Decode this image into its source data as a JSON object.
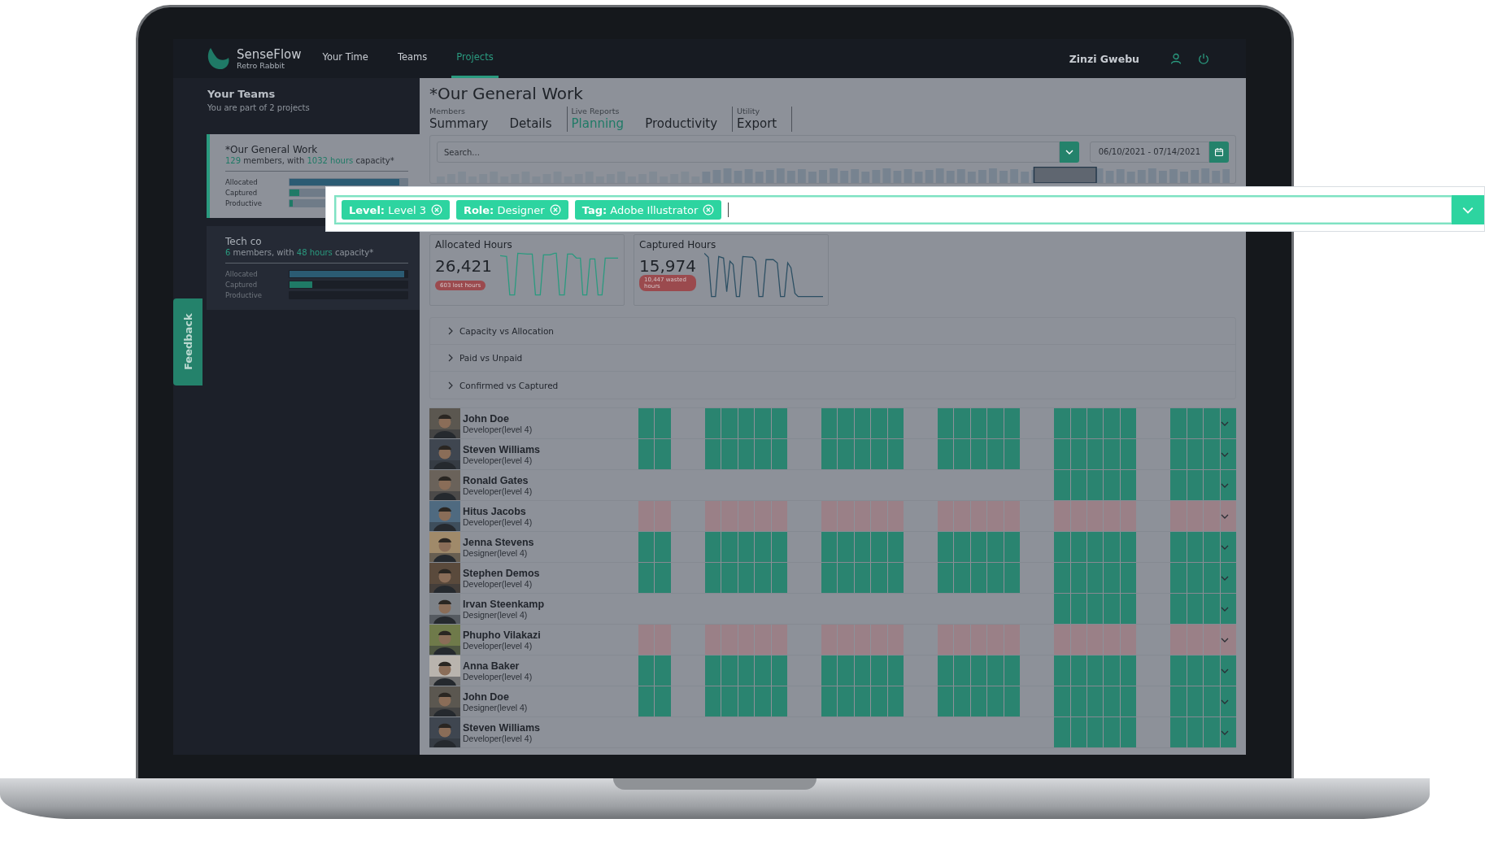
{
  "app": {
    "name": "SenseFlow",
    "subtitle": "Retro Rabbit"
  },
  "nav": [
    {
      "label": "Your Time",
      "selected": false
    },
    {
      "label": "Teams",
      "selected": false
    },
    {
      "label": "Projects",
      "selected": true
    }
  ],
  "user": {
    "name": "Zinzi Gwebu"
  },
  "sidebar": {
    "title": "Your Teams",
    "subtitle": "You are part of 2 projects",
    "teams": [
      {
        "name": "*Our General Work",
        "count": "129",
        "count_unit": "members, with",
        "hours": "1032 hours",
        "hours_unit": "capacity*",
        "selected": true,
        "bars": [
          {
            "label": "Allocated",
            "level": 0.93
          },
          {
            "label": "Captured",
            "level": 0.08
          },
          {
            "label": "Productive",
            "level": 0.03
          }
        ]
      },
      {
        "name": "Tech co",
        "count": "6",
        "count_unit": "members, with",
        "hours": "48 hours",
        "hours_unit": "capacity*",
        "selected": false,
        "bars": [
          {
            "label": "Allocated",
            "level": 0.97
          },
          {
            "label": "Captured",
            "level": 0.19
          },
          {
            "label": "Productive"
          }
        ]
      }
    ]
  },
  "feedback": {
    "label": "Feedback"
  },
  "project": {
    "title": "*Our General Work",
    "tab_groups": [
      {
        "label": "Members",
        "tabs": [
          {
            "label": "Summary",
            "selected": false
          },
          {
            "label": "Details",
            "selected": false
          }
        ]
      },
      {
        "label": "Live Reports",
        "tabs": [
          {
            "label": "Planning",
            "selected": true
          },
          {
            "label": "Productivity",
            "selected": false
          }
        ]
      },
      {
        "label": "Utility",
        "tabs": [
          {
            "label": "Export",
            "selected": false
          }
        ]
      }
    ],
    "search": {
      "placeholder": "Search..."
    },
    "date_range": "06/10/2021 - 07/14/2021",
    "filters": [
      {
        "text": "**Level:** Level 3"
      },
      {
        "text": "**Role:** Designer"
      },
      {
        "text": "**Tag:** Adobe Illustrator"
      }
    ],
    "stats": [
      {
        "title": "Allocated Hours",
        "value": "26,421",
        "badge": "603 lost hours"
      },
      {
        "title": "Captured Hours",
        "value": "15,974",
        "badge": "10,447 wasted hours"
      }
    ],
    "sections": [
      {
        "label": "Capacity vs Allocation",
        "expanded": false
      },
      {
        "label": "Paid vs Unpaid",
        "expanded": false
      },
      {
        "label": "Confirmed vs Captured",
        "expanded": false
      }
    ],
    "members": [
      {
        "name": "John Doe",
        "role": "Developer(level 4)",
        "kind": "full"
      },
      {
        "name": "Steven Williams",
        "role": "Developer(level 4)",
        "kind": "full"
      },
      {
        "name": "Ronald Gates",
        "role": "Developer(level 4)",
        "kind": "late"
      },
      {
        "name": "Hitus Jacobs",
        "role": "Developer(level 4)",
        "kind": "unpaid"
      },
      {
        "name": "Jenna Stevens",
        "role": "Designer(level 4)",
        "kind": "full"
      },
      {
        "name": "Stephen Demos",
        "role": "Developer(level 4)",
        "kind": "full"
      },
      {
        "name": "Irvan Steenkamp",
        "role": "Designer(level 4)",
        "kind": "late"
      },
      {
        "name": "Phupho Vilakazi",
        "role": "Developer(level 4)",
        "kind": "unpaid"
      },
      {
        "name": "Anna Baker",
        "role": "Developer(level 4)",
        "kind": "full"
      },
      {
        "name": "John Doe",
        "role": "Designer(level 4)",
        "kind": "full"
      },
      {
        "name": "Steven Williams",
        "role": "Developer(level 4)",
        "kind": "late"
      }
    ]
  }
}
